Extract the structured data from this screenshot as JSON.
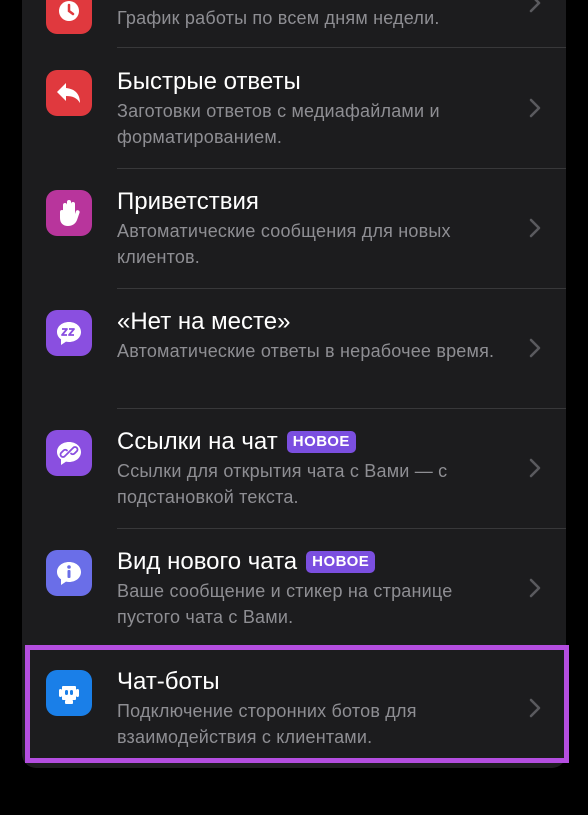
{
  "rows": [
    {
      "title": "",
      "badge": "",
      "desc": "График работы по всем дням недели.",
      "icon": "clock-icon",
      "color": "#e0393e"
    },
    {
      "title": "Быстрые ответы",
      "badge": "",
      "desc": "Заготовки ответов с медиафайлами и форматированием.",
      "icon": "reply-arrow-icon",
      "color": "#e0393e"
    },
    {
      "title": "Приветствия",
      "badge": "",
      "desc": "Автоматические сообщения для новых клиентов.",
      "icon": "waving-hand-icon",
      "color": "#b8359c"
    },
    {
      "title": "«Нет на месте»",
      "badge": "",
      "desc": "Автоматические ответы в нерабочее время.",
      "icon": "sleep-zz-icon",
      "color": "#8a4fe0"
    },
    {
      "title": "Ссылки на чат",
      "badge": "НОВОЕ",
      "desc": "Ссылки для открытия чата с Вами — с подстановкой текста.",
      "icon": "link-icon",
      "color": "#8a4fe0"
    },
    {
      "title": "Вид нового чата",
      "badge": "НОВОЕ",
      "desc": "Ваше сообщение и стикер на странице пустого чата с Вами.",
      "icon": "info-icon",
      "color": "#6a6ee8"
    },
    {
      "title": "Чат-боты",
      "badge": "",
      "desc": "Подключение сторонних ботов для взаимодействия с клиентами.",
      "icon": "robot-icon",
      "color": "#1a7fe8"
    }
  ],
  "colors": {
    "background": "#000000",
    "card": "#1c1c1e",
    "highlight": "#b44ee0",
    "badge": "#7b4fe0"
  }
}
